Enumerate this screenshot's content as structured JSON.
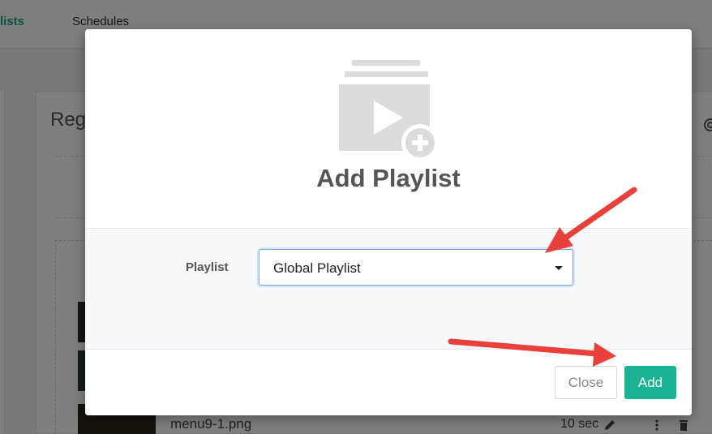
{
  "background": {
    "tabs": [
      {
        "label": "lists"
      },
      {
        "label": "Schedules"
      }
    ],
    "panel_title": "Reg",
    "item": {
      "name": "menu9-1.png",
      "duration": "10 sec"
    }
  },
  "modal": {
    "icon": "playlist-add-icon",
    "title": "Add Playlist",
    "field_label": "Playlist",
    "select_value": "Global Playlist",
    "close_label": "Close",
    "add_label": "Add"
  },
  "colors": {
    "accent": "#1ab394",
    "tab_active": "#16a085",
    "arrow": "#e8413c",
    "focus_border": "#7aa7e6"
  }
}
